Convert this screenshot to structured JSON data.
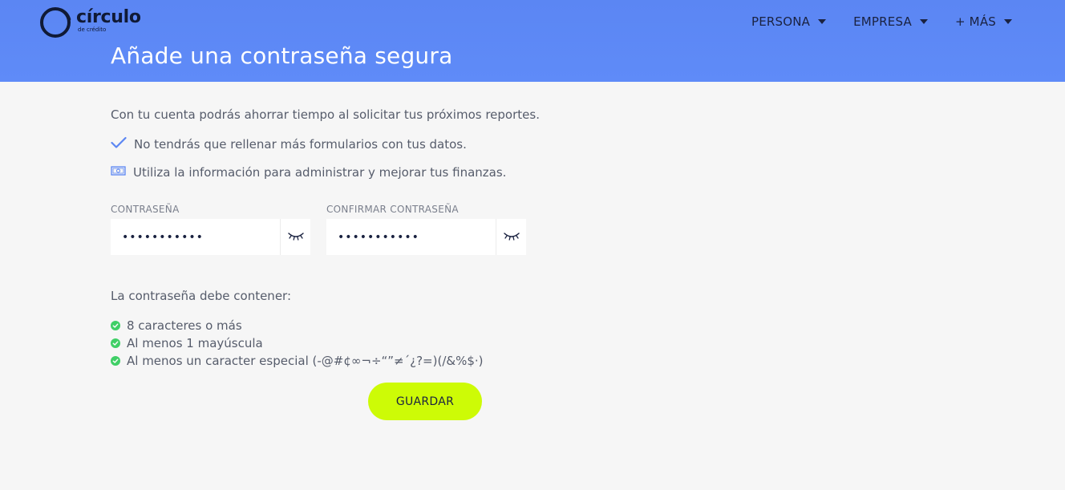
{
  "colors": {
    "header_gradient": "#5b86f3",
    "accent_button": "#cdfb06",
    "check_green": "#3fcf66",
    "check_blue": "#5b86f3",
    "text_dark": "#1a2240",
    "text_body": "#565c6b"
  },
  "brand": {
    "name": "círculo",
    "tagline": "de crédito",
    "icon": "circulo-logo-icon"
  },
  "nav": {
    "items": [
      {
        "label": "PERSONA",
        "icon": "caret-down-icon"
      },
      {
        "label": "EMPRESA",
        "icon": "caret-down-icon"
      },
      {
        "label": "+ MÁS",
        "icon": "caret-down-icon"
      }
    ]
  },
  "page": {
    "title": "Añade una contraseña segura",
    "intro": "Con tu cuenta podrás ahorrar tiempo al solicitar tus próximos reportes.",
    "benefits": [
      {
        "icon": "checkmark-icon",
        "text": "No tendrás que rellenar más formularios con tus datos."
      },
      {
        "icon": "money-bill-icon",
        "text": "Utiliza la información para administrar y mejorar tus finanzas."
      }
    ]
  },
  "form": {
    "password": {
      "label": "CONTRASEÑA",
      "value": "•••••••••••",
      "toggle_icon": "eye-closed-icon"
    },
    "confirm": {
      "label": "CONFIRMAR CONTRASEÑA",
      "value": "•••••••••••",
      "toggle_icon": "eye-closed-icon"
    },
    "requirements_title": "La contraseña debe contener:",
    "requirements": [
      "8 caracteres o más",
      "Al menos 1 mayúscula",
      "Al menos un caracter especial (-@#¢∞¬÷“”≠´¿?=)(/&%$·)"
    ],
    "save_label": "GUARDAR"
  }
}
